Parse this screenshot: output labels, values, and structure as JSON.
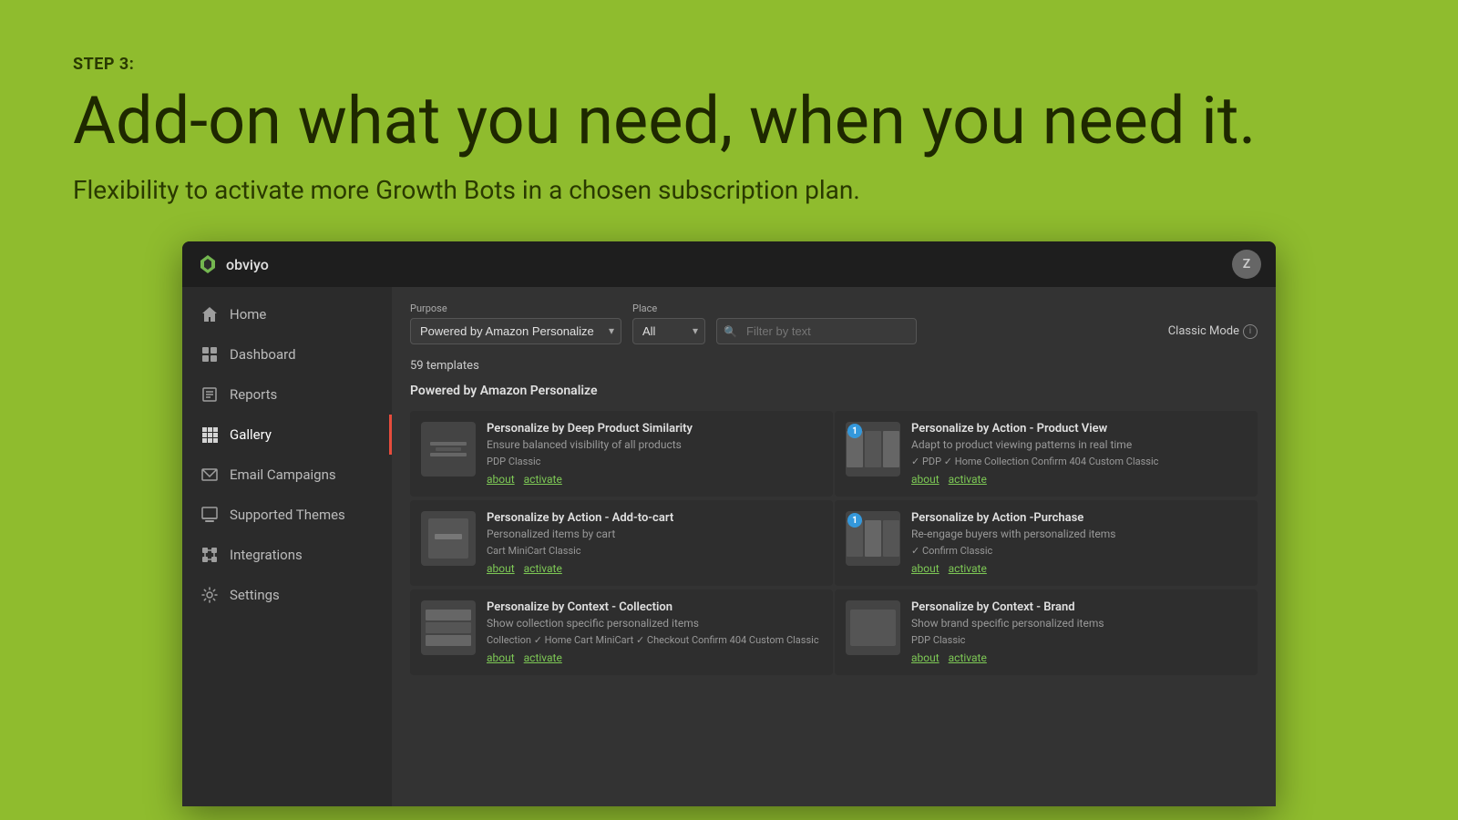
{
  "page": {
    "background_color": "#8fbc2e",
    "step_label": "STEP 3:",
    "headline": "Add-on what you need, when you need it.",
    "subheadline": "Flexibility to activate more Growth Bots in a chosen subscription plan."
  },
  "app": {
    "logo_text": "obviyo",
    "user_initial": "Z",
    "filter": {
      "purpose_label": "Purpose",
      "purpose_value": "Powered by Amazon Personalize",
      "place_label": "Place",
      "place_value": "All",
      "search_placeholder": "Filter by text",
      "classic_mode": "Classic Mode"
    },
    "templates_count": "59 templates",
    "section_title": "Powered by Amazon Personalize"
  },
  "sidebar": {
    "items": [
      {
        "id": "home",
        "label": "Home",
        "icon": "home-icon",
        "active": false
      },
      {
        "id": "dashboard",
        "label": "Dashboard",
        "icon": "dashboard-icon",
        "active": false
      },
      {
        "id": "reports",
        "label": "Reports",
        "icon": "reports-icon",
        "active": false
      },
      {
        "id": "gallery",
        "label": "Gallery",
        "icon": "gallery-icon",
        "active": true
      },
      {
        "id": "email-campaigns",
        "label": "Email Campaigns",
        "icon": "email-icon",
        "active": false
      },
      {
        "id": "supported-themes",
        "label": "Supported Themes",
        "icon": "themes-icon",
        "active": false
      },
      {
        "id": "integrations",
        "label": "Integrations",
        "icon": "integrations-icon",
        "active": false
      },
      {
        "id": "settings",
        "label": "Settings",
        "icon": "settings-icon",
        "active": false
      }
    ]
  },
  "templates": [
    {
      "id": 1,
      "title": "Personalize by Deep Product Similarity",
      "description": "Ensure balanced visibility of all products",
      "tags": "PDP  Classic",
      "badge": null,
      "links": [
        "about",
        "activate"
      ]
    },
    {
      "id": 2,
      "title": "Personalize by Action - Product View",
      "description": "Adapt to product viewing patterns in real time",
      "tags": "✓ PDP  ✓ Home  Collection  Confirm  404  Custom  Classic",
      "badge": "1",
      "links": [
        "about",
        "activate"
      ]
    },
    {
      "id": 3,
      "title": "Personalize by Action - Add-to-cart",
      "description": "Personalized items by cart",
      "tags": "Cart  MiniCart  Classic",
      "badge": null,
      "links": [
        "about",
        "activate"
      ]
    },
    {
      "id": 4,
      "title": "Personalize by Action -Purchase",
      "description": "Re-engage buyers with personalized items",
      "tags": "✓ Confirm  Classic",
      "badge": "1",
      "links": [
        "about",
        "activate"
      ]
    },
    {
      "id": 5,
      "title": "Personalize by Context - Collection",
      "description": "Show collection specific personalized items",
      "tags": "Collection  ✓ Home  Cart  MiniCart  ✓ Checkout  Confirm  404  Custom  Classic",
      "badge": null,
      "links": [
        "about",
        "activate"
      ]
    },
    {
      "id": 6,
      "title": "Personalize by Context - Brand",
      "description": "Show brand specific personalized items",
      "tags": "PDP  Classic",
      "badge": null,
      "links": [
        "about",
        "activate"
      ]
    }
  ]
}
